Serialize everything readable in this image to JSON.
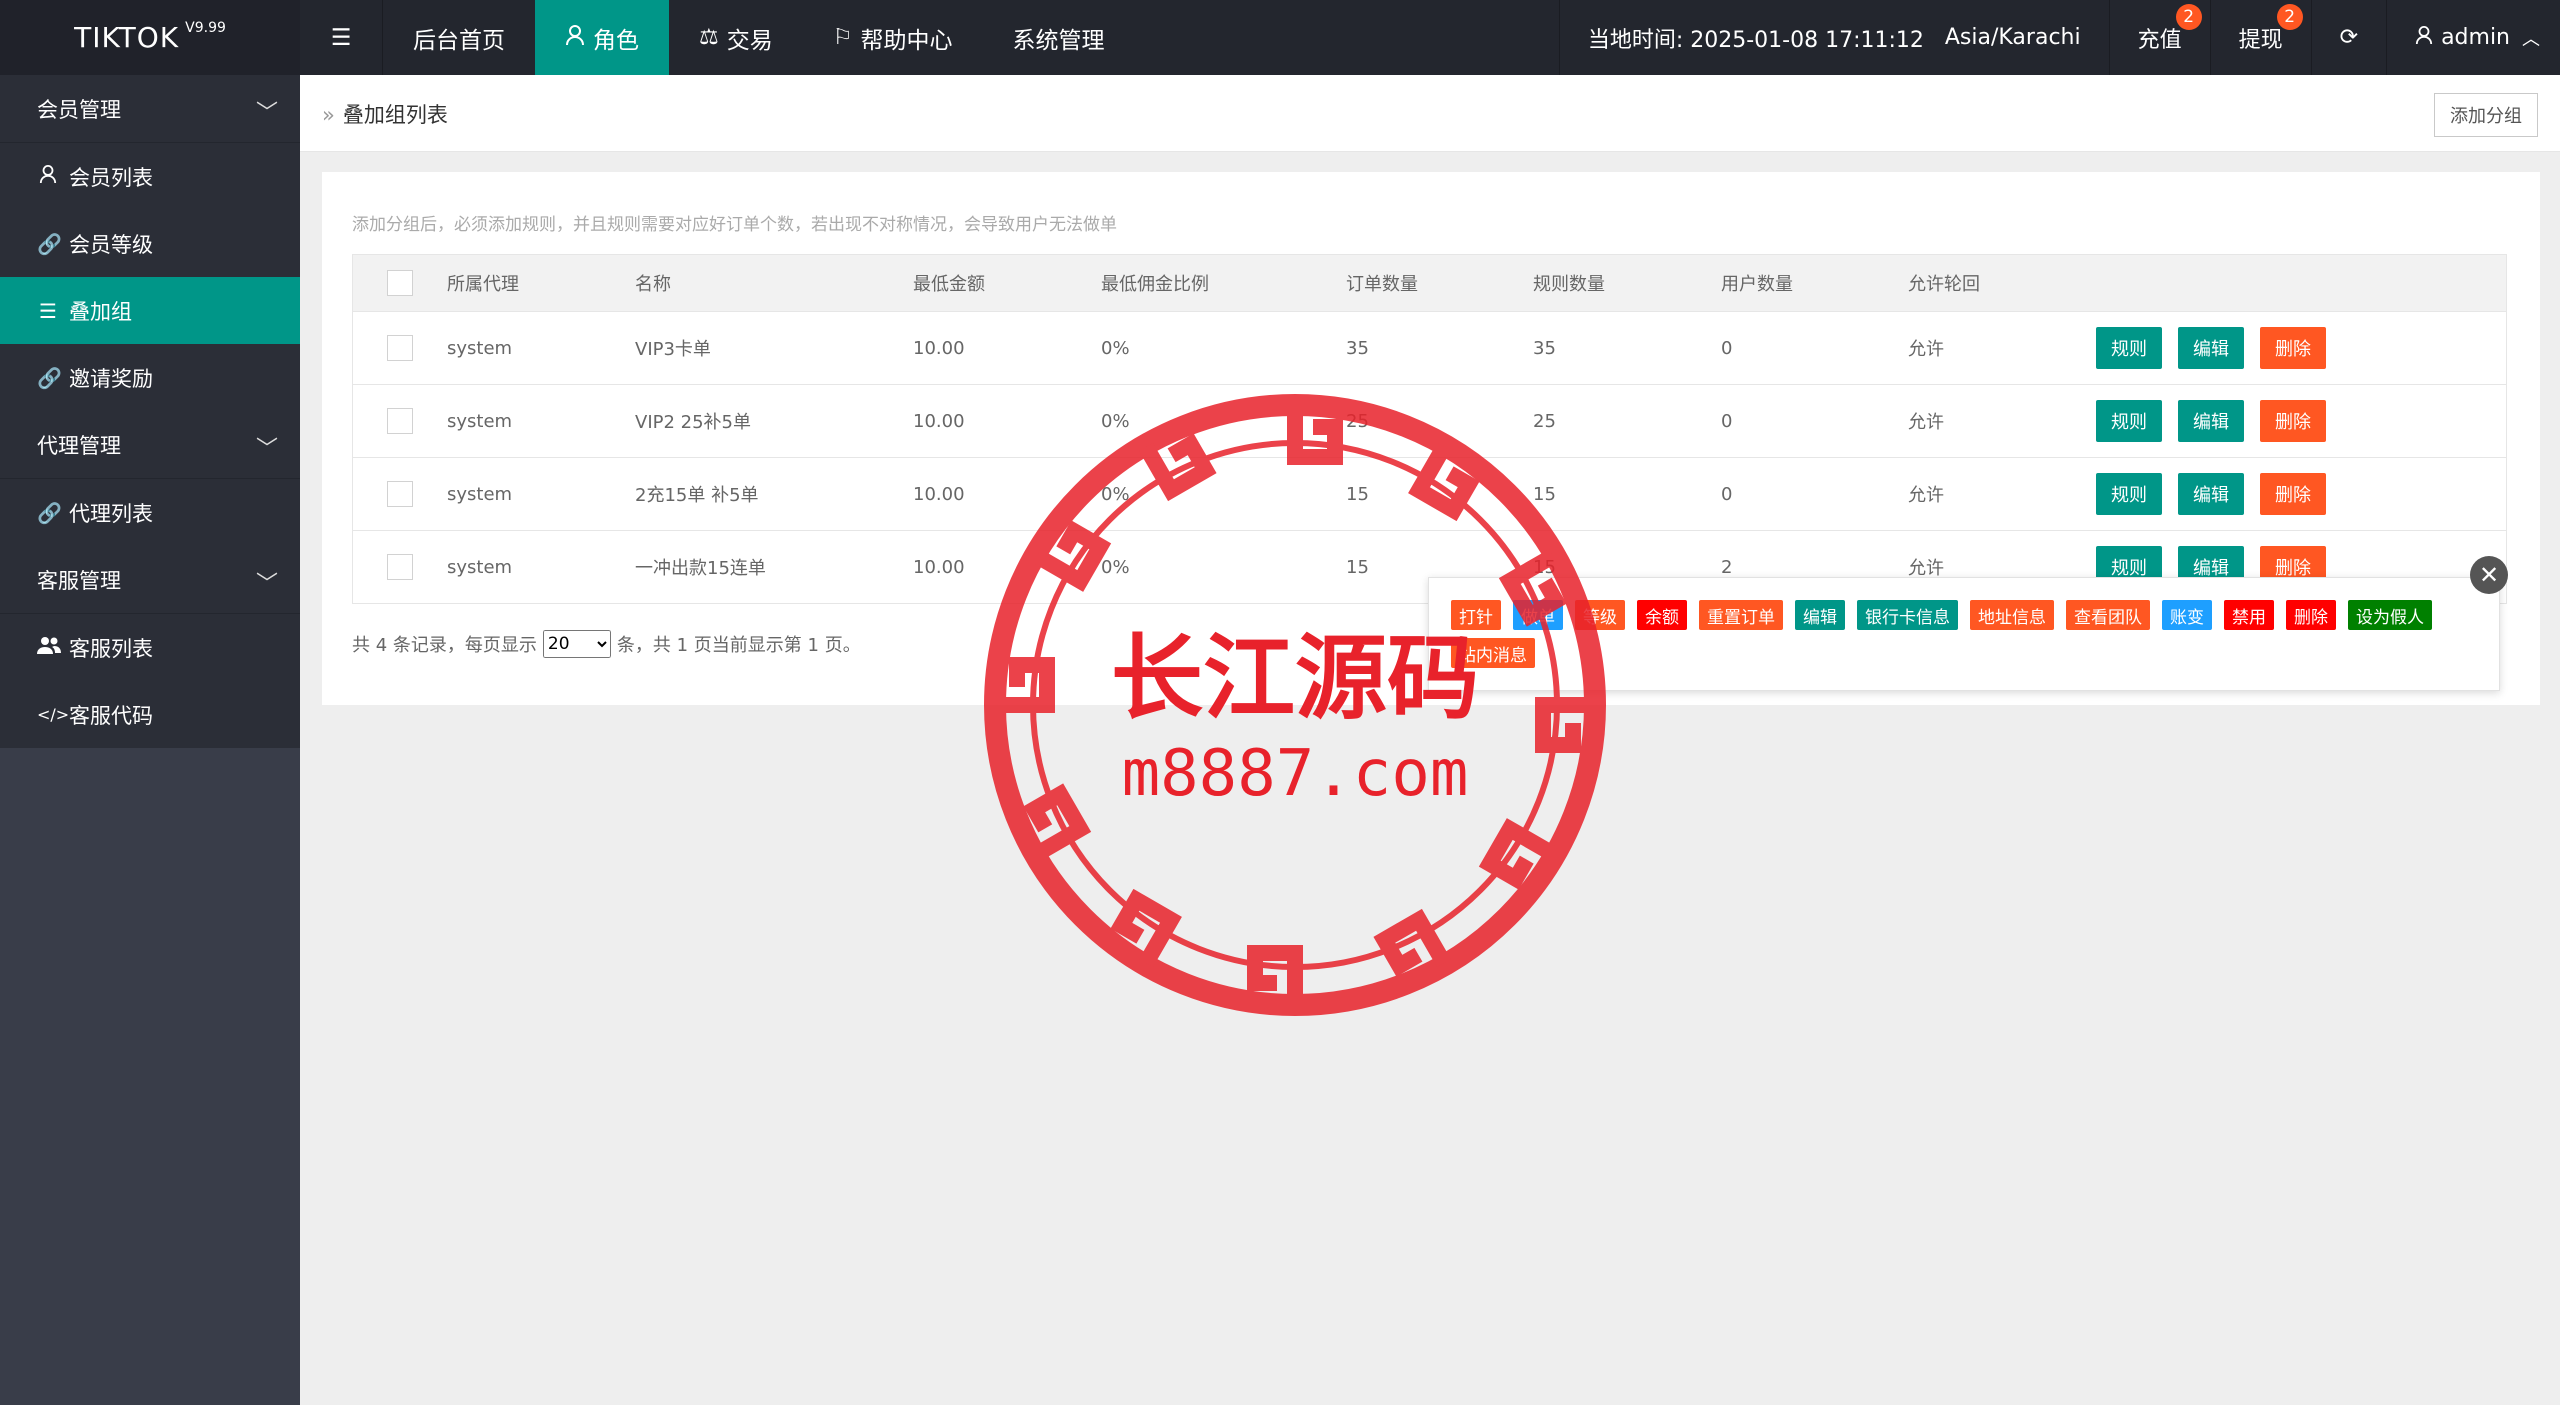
{
  "header": {
    "logo": "TIKTOK",
    "version": "V9.99",
    "nav": [
      {
        "label": "后台首页"
      },
      {
        "label": "角色"
      },
      {
        "label": "交易"
      },
      {
        "label": "帮助中心"
      },
      {
        "label": "系统管理"
      }
    ],
    "time_label": "当地时间: 2025-01-08 17:11:12",
    "timezone": "Asia/Karachi",
    "recharge": "充值",
    "recharge_badge": "2",
    "withdraw": "提现",
    "withdraw_badge": "2",
    "user": "admin"
  },
  "sidebar": {
    "groups": [
      {
        "label": "会员管理",
        "items": [
          {
            "label": "会员列表"
          },
          {
            "label": "会员等级"
          },
          {
            "label": "叠加组"
          },
          {
            "label": "邀请奖励"
          }
        ]
      },
      {
        "label": "代理管理",
        "items": [
          {
            "label": "代理列表"
          }
        ]
      },
      {
        "label": "客服管理",
        "items": [
          {
            "label": "客服列表"
          },
          {
            "label": "客服代码"
          }
        ]
      }
    ]
  },
  "breadcrumb": "叠加组列表",
  "add_button": "添加分组",
  "hint": "添加分组后，必须添加规则，并且规则需要对应好订单个数，若出现不对称情况，会导致用户无法做单",
  "table": {
    "headers": [
      "所属代理",
      "名称",
      "最低金额",
      "最低佣金比例",
      "订单数量",
      "规则数量",
      "用户数量",
      "允许轮回"
    ],
    "rows": [
      {
        "agent": "system",
        "name": "VIP3卡单",
        "min_amount": "10.00",
        "min_rate": "0%",
        "orders": "35",
        "rules": "35",
        "users": "0",
        "loop": "允许"
      },
      {
        "agent": "system",
        "name": "VIP2 25补5单",
        "min_amount": "10.00",
        "min_rate": "0%",
        "orders": "25",
        "rules": "25",
        "users": "0",
        "loop": "允许"
      },
      {
        "agent": "system",
        "name": "2充15单 补5单",
        "min_amount": "10.00",
        "min_rate": "0%",
        "orders": "15",
        "rules": "15",
        "users": "0",
        "loop": "允许"
      },
      {
        "agent": "system",
        "name": "一冲出款15连单",
        "min_amount": "10.00",
        "min_rate": "0%",
        "orders": "15",
        "rules": "15",
        "users": "2",
        "loop": "允许"
      }
    ],
    "actions": {
      "rule": "规则",
      "edit": "编辑",
      "delete": "删除"
    }
  },
  "pager": {
    "prefix": "共 4 条记录，每页显示",
    "page_size": "20",
    "suffix": "条，共 1 页当前显示第 1 页。"
  },
  "popup": {
    "tags": [
      {
        "label": "打针",
        "color": "#ff5722"
      },
      {
        "label": "做单",
        "color": "#1e9fff"
      },
      {
        "label": "等级",
        "color": "#ff5722"
      },
      {
        "label": "余额",
        "color": "#ff0000"
      },
      {
        "label": "重置订单",
        "color": "#ff5722"
      },
      {
        "label": "编辑",
        "color": "#009688"
      },
      {
        "label": "银行卡信息",
        "color": "#009688"
      },
      {
        "label": "地址信息",
        "color": "#ff5722"
      },
      {
        "label": "查看团队",
        "color": "#ff5722"
      },
      {
        "label": "账变",
        "color": "#1e9fff"
      },
      {
        "label": "禁用",
        "color": "#ff0000"
      },
      {
        "label": "删除",
        "color": "#ff0000"
      },
      {
        "label": "设为假人",
        "color": "#008000"
      },
      {
        "label": "站内消息",
        "color": "#ff5722"
      }
    ]
  },
  "watermark": {
    "title": "长江源码",
    "url": "m8887.com"
  },
  "colors": {
    "accent": "#009688",
    "danger": "#ff5722",
    "header": "#23262e",
    "sidebar": "#2b2e37"
  }
}
